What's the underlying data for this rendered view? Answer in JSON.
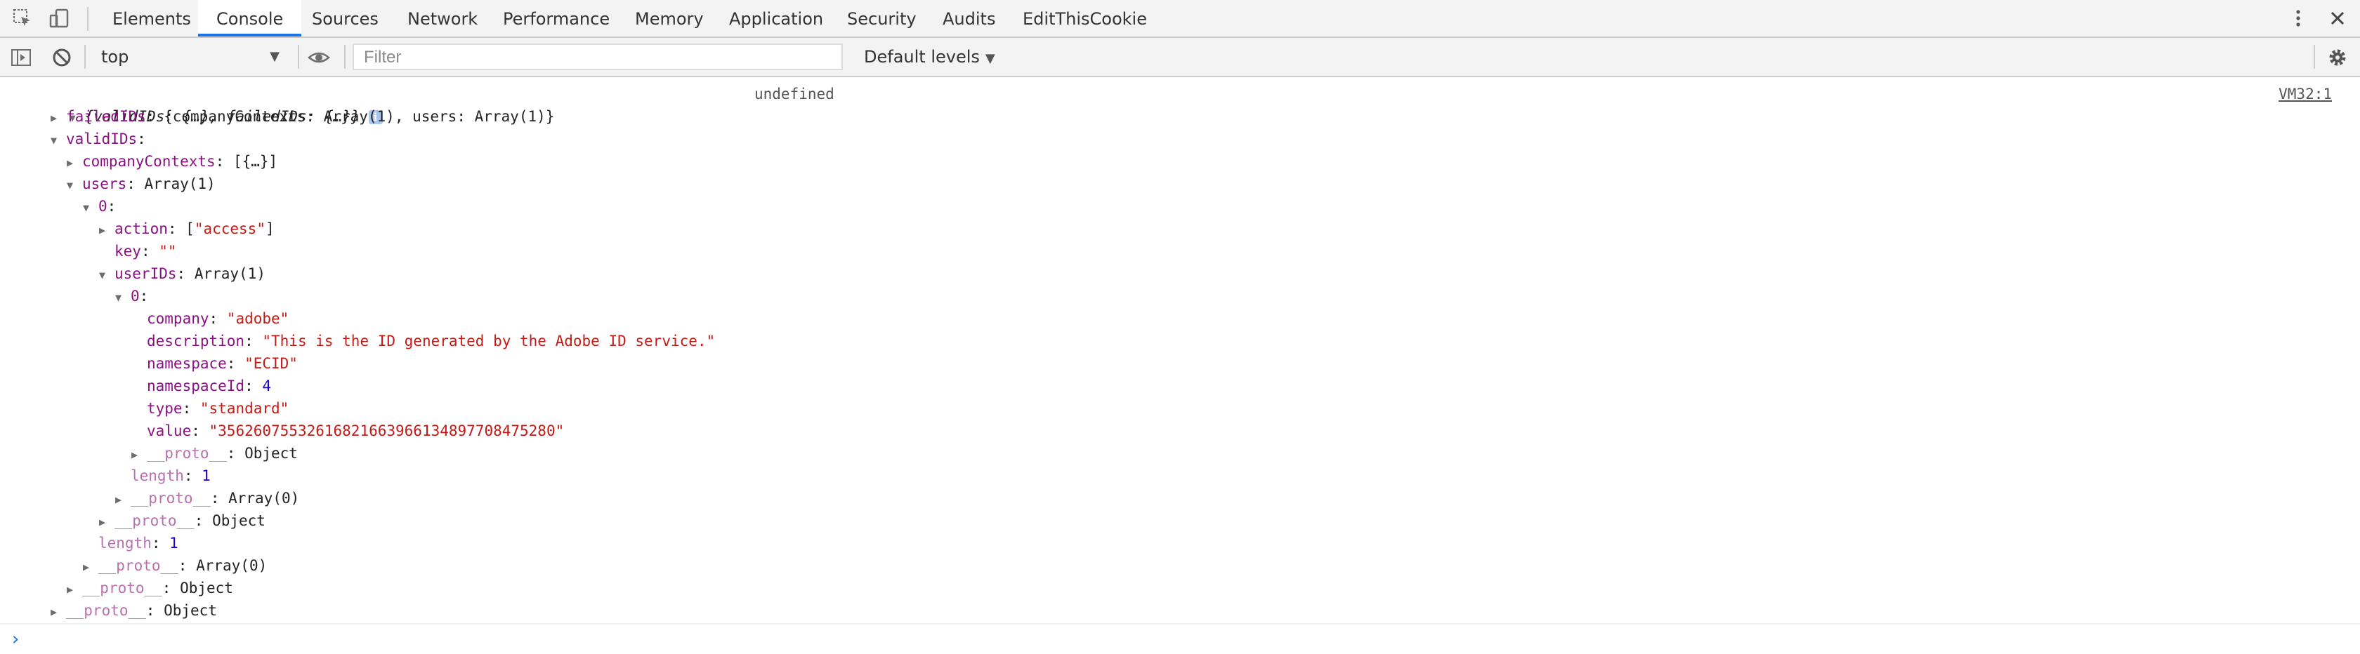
{
  "tabs": [
    "Elements",
    "Console",
    "Sources",
    "Network",
    "Performance",
    "Memory",
    "Application",
    "Security",
    "Audits",
    "EditThisCookie"
  ],
  "active_tab": "Console",
  "toolbar": {
    "context": "top",
    "filter_placeholder": "Filter",
    "levels": "Default levels"
  },
  "console": {
    "summary": "{validIDs: {…}, failedIDs: {…}}",
    "result": "undefined",
    "source": "VM32:1",
    "lines": [
      {
        "k": "failedIDs",
        "v": "{companyContexts: Array(1), users: Array(1)}",
        "vt": "obj"
      },
      {
        "k": "validIDs",
        "v": "",
        "vt": "obj"
      },
      {
        "k": "companyContexts",
        "v": "[{…}]",
        "vt": "obj"
      },
      {
        "k": "users",
        "v": "Array(1)",
        "vt": "obj"
      },
      {
        "k": "0",
        "v": "",
        "vt": "obj"
      },
      {
        "k": "action",
        "v": "[\"access\"]",
        "vt": "arr"
      },
      {
        "k": "key",
        "v": "\"\"",
        "vt": "str"
      },
      {
        "k": "userIDs",
        "v": "Array(1)",
        "vt": "obj"
      },
      {
        "k": "0",
        "v": "",
        "vt": "obj"
      },
      {
        "k": "company",
        "v": "\"adobe\"",
        "vt": "str"
      },
      {
        "k": "description",
        "v": "\"This is the ID generated by the Adobe ID service.\"",
        "vt": "str"
      },
      {
        "k": "namespace",
        "v": "\"ECID\"",
        "vt": "str"
      },
      {
        "k": "namespaceId",
        "v": "4",
        "vt": "num"
      },
      {
        "k": "type",
        "v": "\"standard\"",
        "vt": "str"
      },
      {
        "k": "value",
        "v": "\"35626075532616821663966134897708475280\"",
        "vt": "str"
      },
      {
        "k": "__proto__",
        "v": "Object",
        "vt": "obj"
      },
      {
        "k": "length",
        "v": "1",
        "vt": "num"
      },
      {
        "k": "__proto__",
        "v": "Array(0)",
        "vt": "obj"
      },
      {
        "k": "__proto__",
        "v": "Object",
        "vt": "obj"
      },
      {
        "k": "length",
        "v": "1",
        "vt": "num"
      },
      {
        "k": "__proto__",
        "v": "Array(0)",
        "vt": "obj"
      },
      {
        "k": "__proto__",
        "v": "Object",
        "vt": "obj"
      },
      {
        "k": "__proto__",
        "v": "Object",
        "vt": "obj"
      }
    ]
  }
}
